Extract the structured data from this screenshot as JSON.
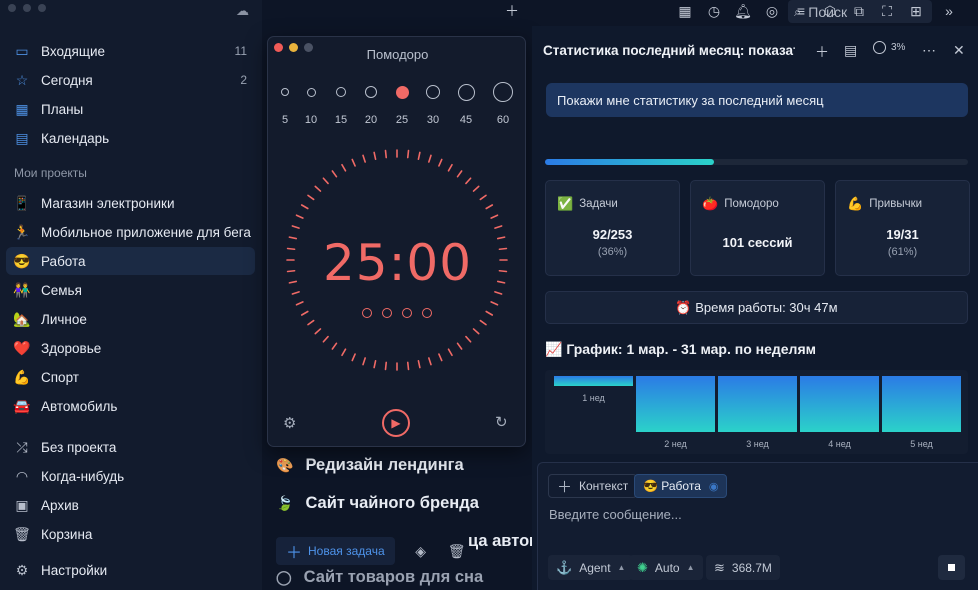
{
  "sidebar": {
    "inbox": {
      "label": "Входящие",
      "count": "11"
    },
    "today": {
      "label": "Сегодня",
      "count": "2"
    },
    "plans": {
      "label": "Планы"
    },
    "calendar": {
      "label": "Календарь"
    },
    "projects_title": "Мои проекты",
    "projects": [
      {
        "emoji": "📱",
        "label": "Магазин электроники"
      },
      {
        "emoji": "🏃",
        "label": "Мобильное приложение для бега"
      },
      {
        "emoji": "😎",
        "label": "Работа"
      },
      {
        "emoji": "👫",
        "label": "Семья"
      },
      {
        "emoji": "🏡",
        "label": "Личное"
      },
      {
        "emoji": "❤️",
        "label": "Здоровье"
      },
      {
        "emoji": "💪",
        "label": "Спорт"
      },
      {
        "emoji": "🚘",
        "label": "Автомобиль"
      }
    ],
    "no_project": "Без проекта",
    "someday": "Когда-нибудь",
    "archive": "Архив",
    "trash": "Корзина",
    "settings": "Настройки"
  },
  "toolbar": {
    "search_placeholder": "Поиск",
    "icons": [
      "plus-icon",
      "calendar-icon",
      "stopwatch-icon",
      "bell-icon",
      "target-icon",
      "filter-icon",
      "tag-icon",
      "export-icon",
      "focus-icon",
      "add-window-icon",
      "chevrons-right-icon"
    ]
  },
  "tasks": [
    {
      "emoji": "🎨",
      "label": "Редизайн лендинга"
    },
    {
      "emoji": "🍃",
      "label": "Сайт чайного бренда"
    },
    {
      "emoji": "",
      "label": "ца автом"
    },
    {
      "emoji": "",
      "label": "Сайт товаров для сна"
    }
  ],
  "bottom_bar": {
    "new_task": "Новая задача"
  },
  "pomodoro": {
    "title": "Помодоро",
    "durations": [
      "5",
      "10",
      "15",
      "20",
      "25",
      "30",
      "45",
      "60"
    ],
    "selected": "25",
    "time": "25:00",
    "accent": "#f06a66"
  },
  "panel": {
    "title": "Статистика последний месяц: показать",
    "percent": "3%",
    "user_message": "Покажи мне статистику за последний месяц",
    "progress": 0.4,
    "stats": [
      {
        "emoji": "✅",
        "label": "Задачи",
        "value": "92/253",
        "sub": "(36%)"
      },
      {
        "emoji": "🍅",
        "label": "Помодоро",
        "value": "101 сессий",
        "sub": ""
      },
      {
        "emoji": "💪",
        "label": "Привычки",
        "value": "19/31",
        "sub": "(61%)"
      }
    ],
    "work_time": "⏰ Время работы: 30ч 47м",
    "chart_title": "📈 График: 1 мар. - 31 мар. по неделям"
  },
  "chart_data": {
    "type": "bar",
    "categories": [
      "1 нед",
      "2 нед",
      "3 нед",
      "4 нед",
      "5 нед"
    ],
    "values": [
      0.15,
      1,
      1,
      1,
      1
    ],
    "ylim": [
      0,
      1
    ],
    "grid": false,
    "colors": [
      "#2b7be6",
      "#2bd2c9"
    ]
  },
  "composer": {
    "context": "Контекст",
    "project": "😎 Работа",
    "placeholder": "Введите сообщение...",
    "agent": "Agent",
    "model": "Auto",
    "tokens": "368.7M"
  }
}
